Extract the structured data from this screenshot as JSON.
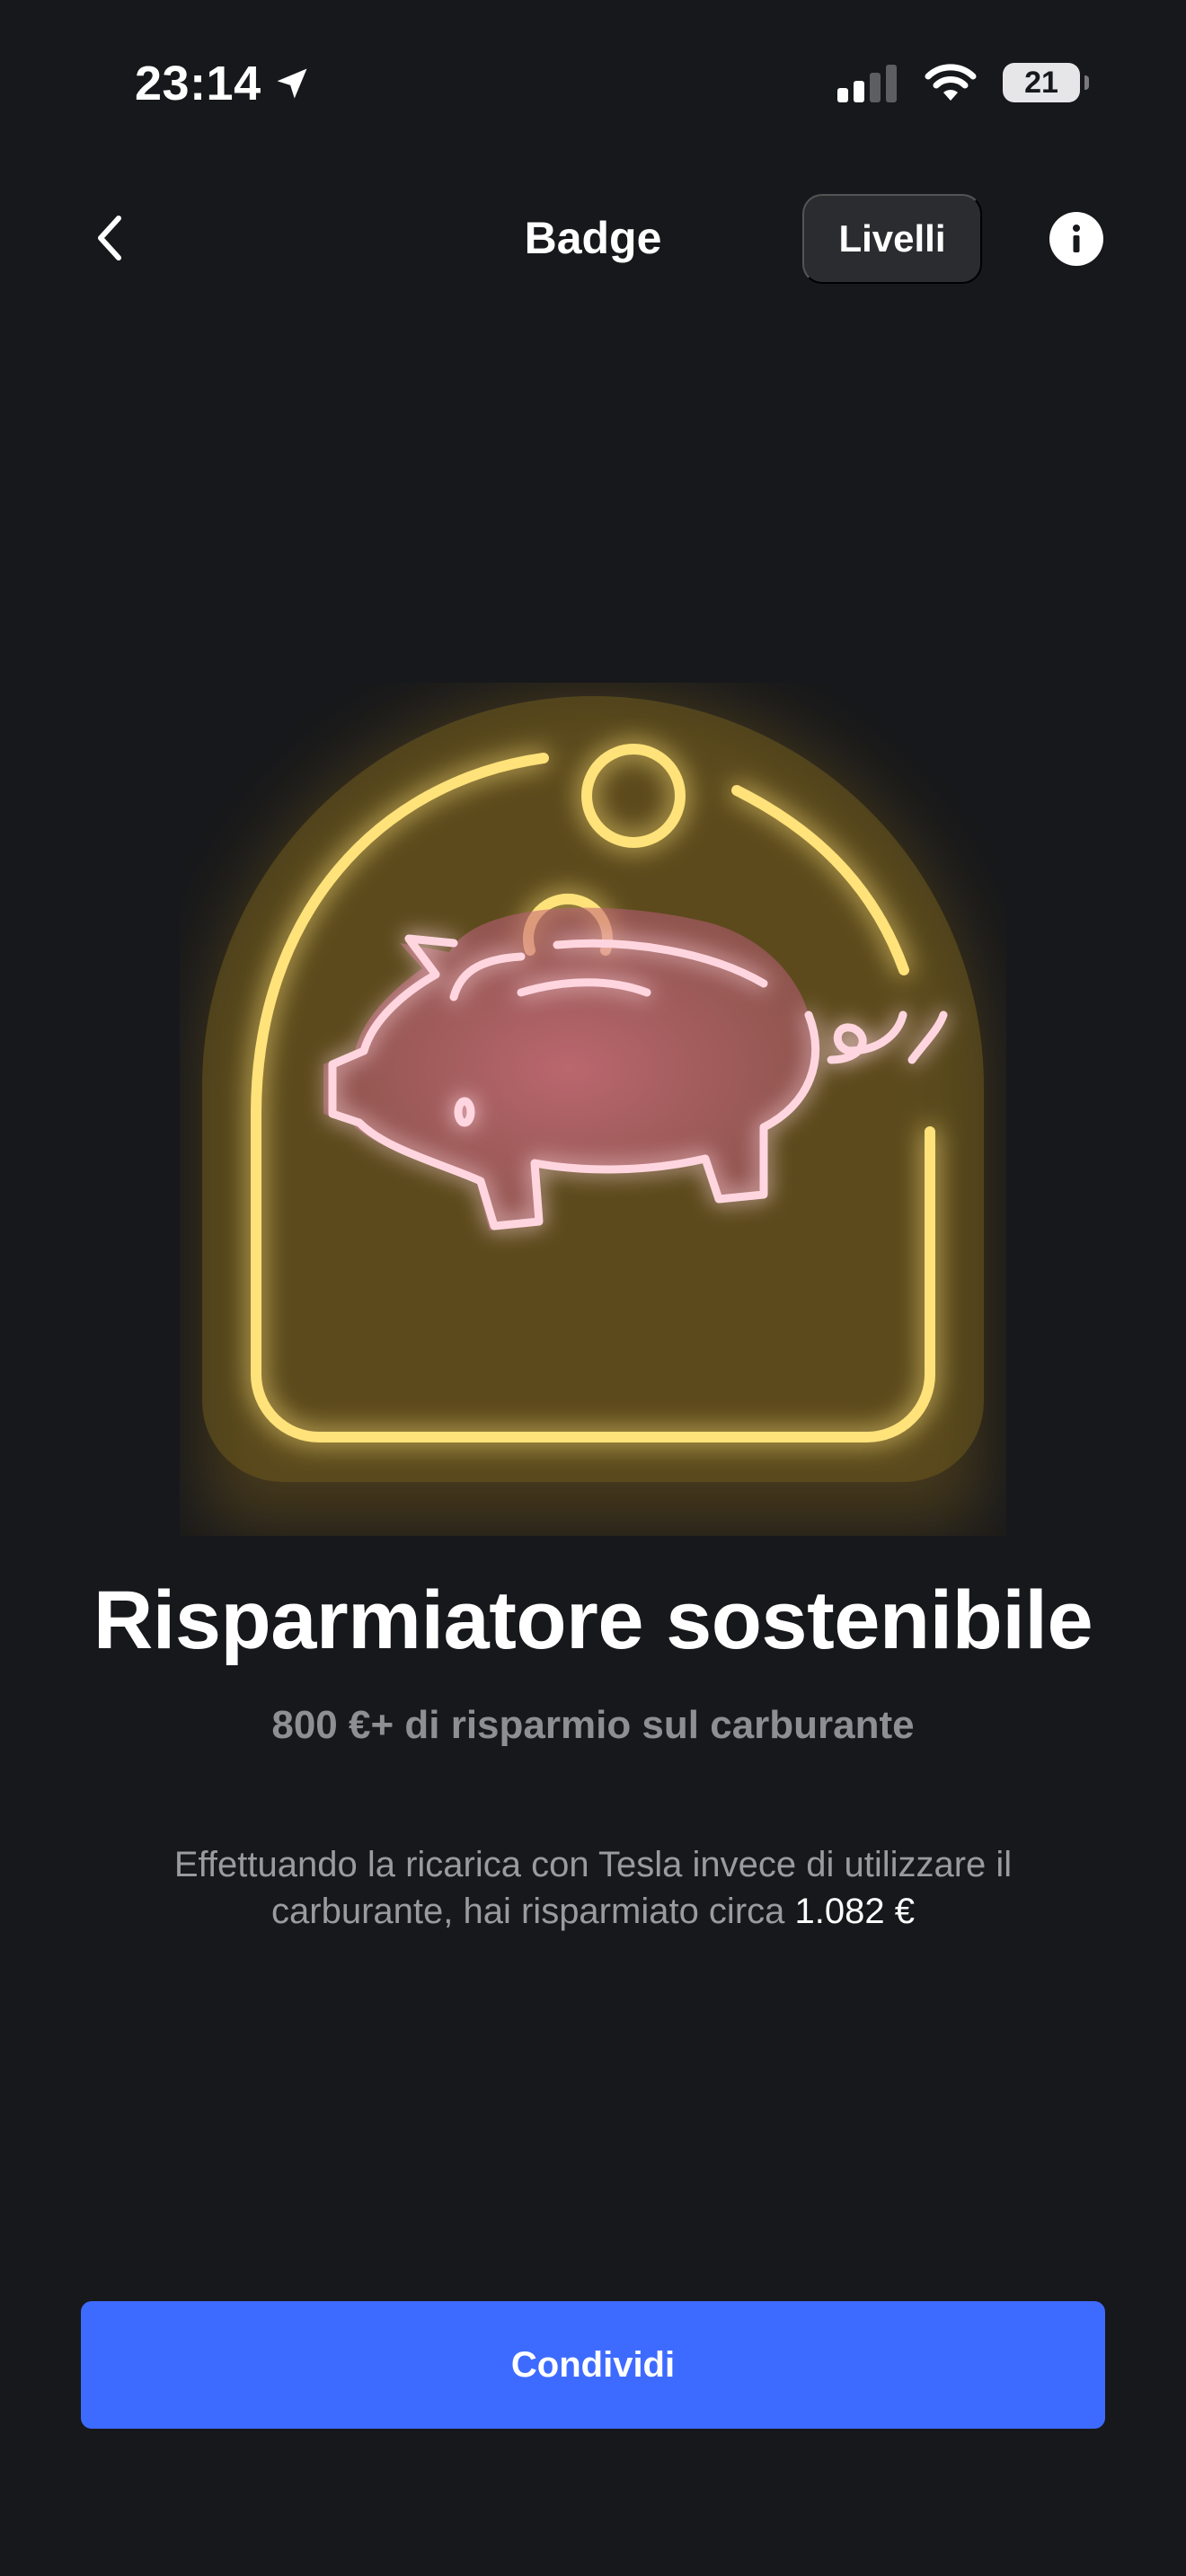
{
  "status_bar": {
    "time": "23:14",
    "battery": "21",
    "icons": [
      "location-arrow-icon",
      "signal-icon",
      "wifi-icon",
      "battery-icon"
    ]
  },
  "nav": {
    "title": "Badge",
    "levels_label": "Livelli",
    "back_icon": "chevron-left-icon",
    "info_icon": "info-icon"
  },
  "badge": {
    "title": "Risparmiatore sostenibile",
    "subtitle": "800 €+ di risparmio sul carburante",
    "description_prefix": "Effettuando la ricarica con Tesla invece di utilizzare il carburante, hai risparmiato circa ",
    "savings_amount": "1.082 €",
    "illustration": "piggy-bank-neon-icon"
  },
  "actions": {
    "share_label": "Condividi"
  },
  "colors": {
    "background": "#17181b",
    "accent_button": "#3e6bff",
    "neon_gold": "#ffd84a",
    "neon_pink": "#ff9cb0"
  }
}
